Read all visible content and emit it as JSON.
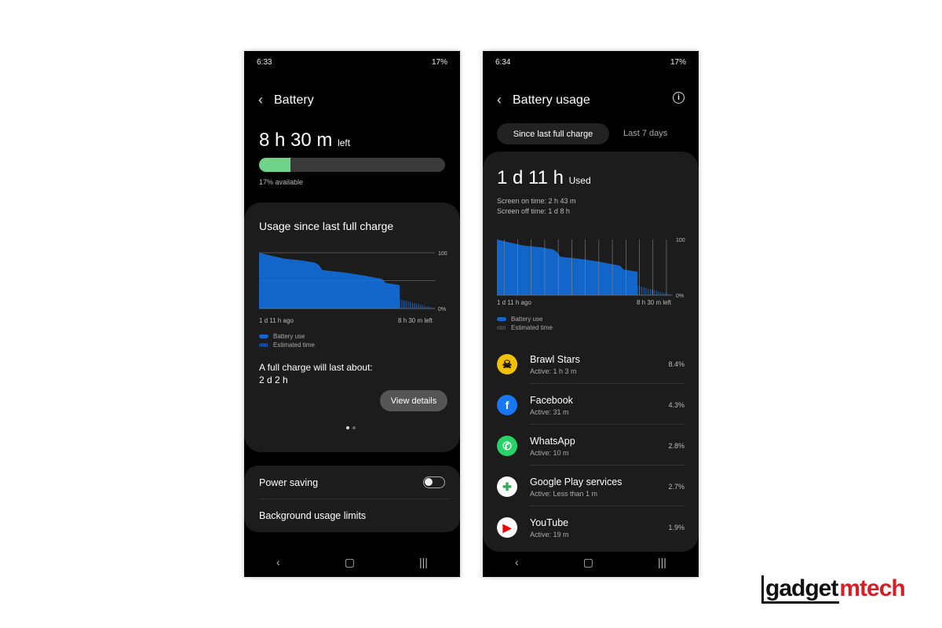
{
  "left": {
    "status": {
      "time": "6:33",
      "battery": "17%"
    },
    "title": "Battery",
    "time_left": "8 h 30 m",
    "time_left_suffix": "left",
    "battery_level": 17,
    "available": "17% available",
    "card": {
      "title": "Usage since last full charge",
      "axis_top": "100",
      "axis_bottom": "0%",
      "x_start": "1 d 11 h ago",
      "x_end": "8 h 30 m left",
      "legend_use": "Battery use",
      "legend_est": "Estimated time",
      "full_charge_label": "A full charge will last about:",
      "full_charge_value": "2 d 2 h",
      "view_details": "View details"
    },
    "power_saving": "Power saving",
    "power_saving_on": false,
    "background_limits": "Background usage limits"
  },
  "right": {
    "status": {
      "time": "6:34",
      "battery": "17%"
    },
    "title": "Battery usage",
    "tabs": [
      "Since last full charge",
      "Last 7 days"
    ],
    "used": "1 d 11 h",
    "used_suffix": "Used",
    "screen_on": "Screen on time: 2 h 43 m",
    "screen_off": "Screen off time: 1 d 8 h",
    "axis_top": "100",
    "axis_bottom": "0%",
    "x_start": "1 d 11 h ago",
    "x_end": "8 h 30 m left",
    "legend_use": "Battery use",
    "legend_est": "Estimated time",
    "apps": [
      {
        "name": "Brawl Stars",
        "active": "Active: 1 h 3 m",
        "pct": "8.4%",
        "color": "#f2c200",
        "glyph": "☠"
      },
      {
        "name": "Facebook",
        "active": "Active: 31 m",
        "pct": "4.3%",
        "color": "#1877f2",
        "glyph": "f"
      },
      {
        "name": "WhatsApp",
        "active": "Active: 10 m",
        "pct": "2.8%",
        "color": "#25d366",
        "glyph": "✆"
      },
      {
        "name": "Google Play services",
        "active": "Active: Less than 1 m",
        "pct": "2.7%",
        "color": "#ffffff",
        "glyph": "✚"
      },
      {
        "name": "YouTube",
        "active": "Active: 19 m",
        "pct": "1.9%",
        "color": "#ffffff",
        "glyph": "▶"
      }
    ]
  },
  "chart_data": {
    "type": "area",
    "ylim": [
      0,
      100
    ],
    "x_start_label": "1 d 11 h ago",
    "x_end_label": "8 h 30 m left",
    "battery_use": [
      [
        0,
        100
      ],
      [
        0.08,
        94
      ],
      [
        0.15,
        89
      ],
      [
        0.25,
        86
      ],
      [
        0.32,
        82
      ],
      [
        0.34,
        78
      ],
      [
        0.36,
        69
      ],
      [
        0.5,
        64
      ],
      [
        0.6,
        59
      ],
      [
        0.7,
        53
      ],
      [
        0.72,
        46
      ],
      [
        0.8,
        42
      ],
      [
        0.8,
        17
      ]
    ],
    "estimated": [
      [
        0.8,
        17
      ],
      [
        1,
        0
      ]
    ],
    "colors": {
      "battery_use": "#1366c9"
    }
  },
  "watermark": "gadgetmtech"
}
